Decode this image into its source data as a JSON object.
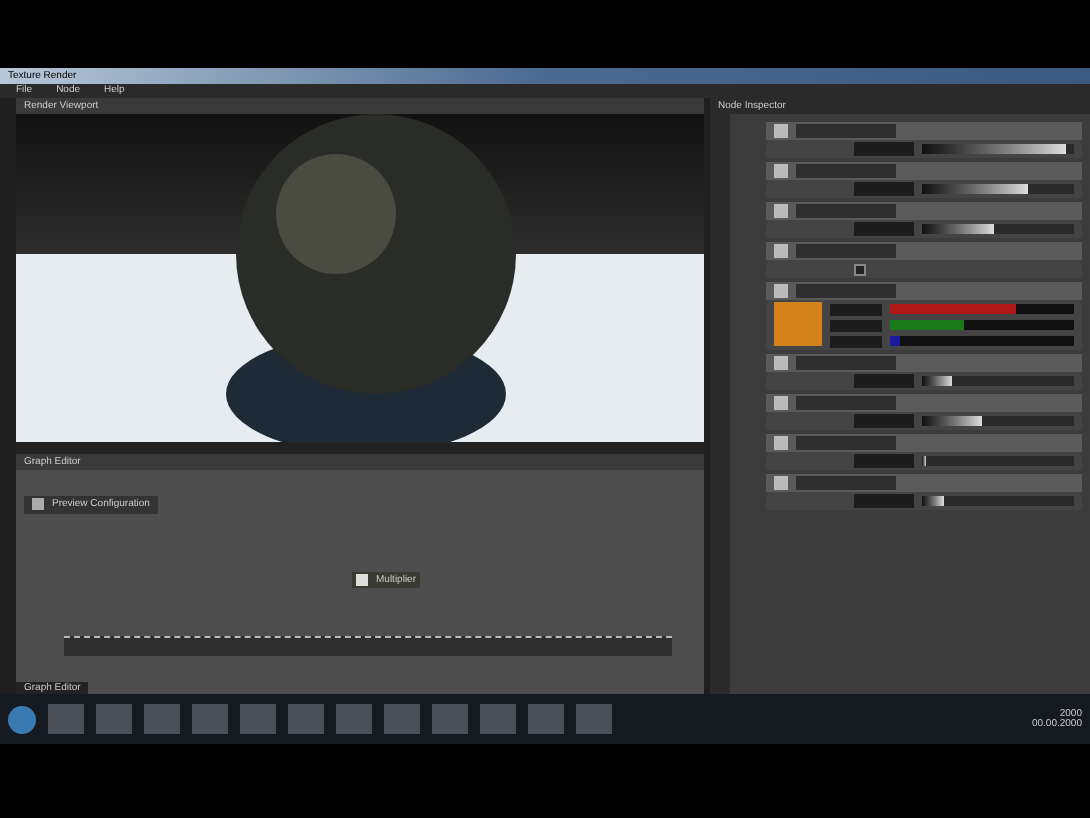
{
  "window": {
    "title": "Texture Render"
  },
  "menu": [
    {
      "label": "File"
    },
    {
      "label": "Node"
    },
    {
      "label": "Help"
    }
  ],
  "viewport": {
    "title": "Render Viewport"
  },
  "graph": {
    "title": "Graph Editor",
    "frame_label": "Preview Configuration",
    "node_label": "Multiplier",
    "tab": "Graph Editor"
  },
  "inspector": {
    "title": "Node Inspector",
    "params": [
      {
        "kind": "slider",
        "level": 0.95
      },
      {
        "kind": "slider",
        "level": 0.7
      },
      {
        "kind": "slider",
        "level": 0.48
      },
      {
        "kind": "toggle",
        "checked": false
      },
      {
        "kind": "color",
        "color": "#d4821c",
        "channels": [
          {
            "color": "#b01818",
            "level": 0.68
          },
          {
            "color": "#187a18",
            "level": 0.4
          },
          {
            "color": "#1a1aa0",
            "level": 0.05
          }
        ]
      },
      {
        "kind": "slider",
        "level": 0.2
      },
      {
        "kind": "slider",
        "level": 0.4
      },
      {
        "kind": "slider",
        "level": 0.02
      },
      {
        "kind": "slider",
        "level": 0.15
      }
    ]
  },
  "clock": {
    "time": "2000",
    "date": "00.00.2000"
  }
}
